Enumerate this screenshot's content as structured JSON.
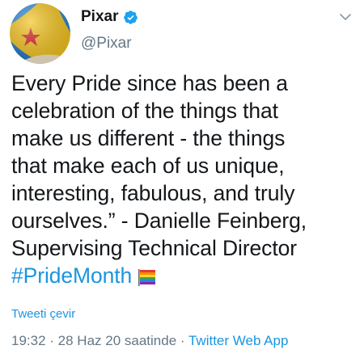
{
  "author": {
    "display_name": "Pixar",
    "handle": "@Pixar",
    "avatar_icon": "pixar-ball-avatar",
    "verified_icon": "verified-badge-icon"
  },
  "tweet": {
    "lines": [
      "Every Pride since has been a",
      "celebration of the things that",
      "make us different - the things",
      "that make each of us unique,",
      "interesting, fabulous, and truly",
      "ourselves.” - Danielle Feinberg,",
      "Supervising Technical Director"
    ],
    "hashtag": "#PrideMonth",
    "emoji_icon": "rainbow-flag-icon"
  },
  "translate_label": "Tweeti çevir",
  "meta": {
    "time": "19:32",
    "sep1": " · ",
    "date": "28 Haz 20 saatinde",
    "sep2": " · ",
    "source": "Twitter Web App"
  },
  "colors": {
    "link": "#1b95e0",
    "secondary": "#657786",
    "text": "#14171a"
  }
}
